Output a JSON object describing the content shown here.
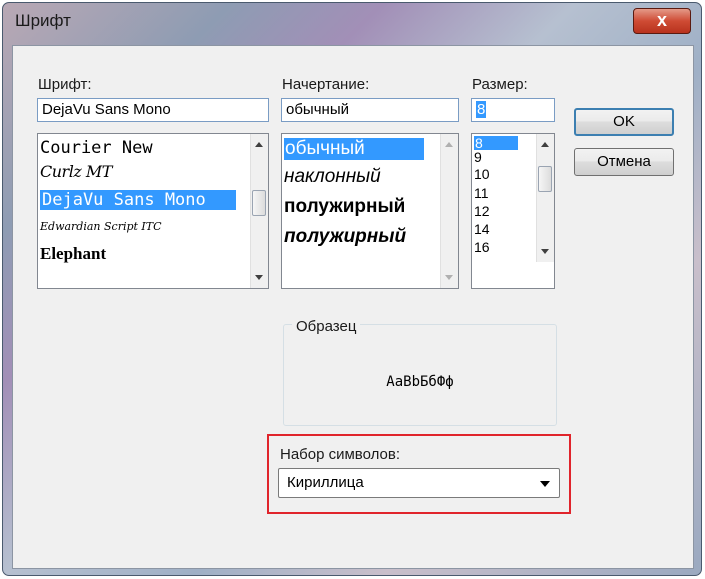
{
  "window": {
    "title": "Шрифт",
    "close_glyph": "x"
  },
  "font": {
    "label": "Шрифт:",
    "value": "DejaVu Sans Mono",
    "items": [
      "Courier New",
      "Curlz MT",
      "DejaVu Sans Mono",
      "Edwardian Script ITC",
      "Elephant"
    ],
    "selected_index": 2
  },
  "style": {
    "label": "Начертание:",
    "value": "обычный",
    "items": [
      "обычный",
      "наклонный",
      "полужирный",
      "полужирный"
    ],
    "selected_index": 0
  },
  "size": {
    "label": "Размер:",
    "value": "8",
    "items": [
      "8",
      "9",
      "10",
      "11",
      "12",
      "14",
      "16"
    ],
    "selected_index": 0
  },
  "buttons": {
    "ok": "OK",
    "cancel": "Отмена"
  },
  "sample": {
    "label": "Образец",
    "text": "AaBbБбФф"
  },
  "charset": {
    "label": "Набор символов:",
    "value": "Кириллица"
  },
  "colors": {
    "selection": "#3399ff",
    "highlight_border": "#e0242b"
  },
  "icons": [
    "close-icon",
    "scroll-up-icon",
    "scroll-down-icon",
    "dropdown-arrow-icon"
  ]
}
